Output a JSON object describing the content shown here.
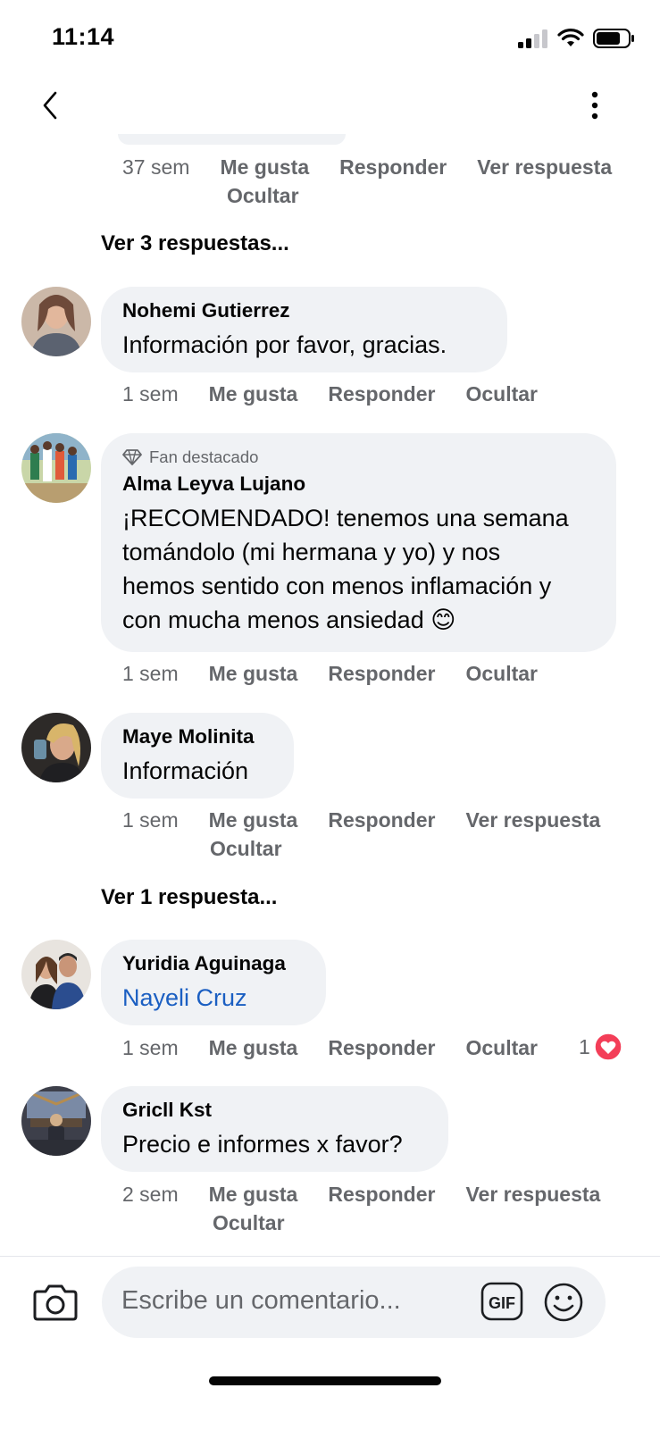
{
  "status": {
    "time": "11:14"
  },
  "prev_comment": {
    "time": "37 sem",
    "actions": [
      "Me gusta",
      "Responder",
      "Ver respuesta",
      "Ocultar"
    ]
  },
  "view_replies_1": "Ver 3 respuestas...",
  "comments": [
    {
      "author": "Nohemi Gutierrez",
      "text": "Información por favor,  gracias.",
      "time": "1 sem",
      "actions": [
        "Me gusta",
        "Responder",
        "Ocultar"
      ]
    },
    {
      "badge": "Fan destacado",
      "author": "Alma Leyva Lujano",
      "text_lines": [
        "¡RECOMENDADO! tenemos una semana",
        "tomándolo (mi hermana y yo) y nos",
        "hemos sentido con menos inflamación y",
        "con mucha menos ansiedad 😊"
      ],
      "time": "1 sem",
      "actions": [
        "Me gusta",
        "Responder",
        "Ocultar"
      ]
    },
    {
      "author": "Maye Molinita",
      "text": "Información",
      "time": "1 sem",
      "actions": [
        "Me gusta",
        "Responder",
        "Ver respuesta",
        "Ocultar"
      ]
    },
    {
      "author": "Yuridia Aguinaga",
      "text": "Nayeli Cruz",
      "time": "1 sem",
      "actions": [
        "Me gusta",
        "Responder",
        "Ocultar"
      ],
      "reaction_count": "1"
    },
    {
      "author": "Gricll Kst",
      "text": "Precio e informes x favor?",
      "time": "2 sem",
      "actions": [
        "Me gusta",
        "Responder",
        "Ver respuesta",
        "Ocultar"
      ]
    }
  ],
  "view_replies_2": "Ver 1 respuesta...",
  "composer": {
    "placeholder": "Escribe un comentario...",
    "gif_label": "GIF"
  },
  "colors": {
    "bubble": "#f0f2f5",
    "mention": "#1b5fc2",
    "reaction": "#f33e58",
    "meta": "#65676b"
  },
  "icons": [
    "back-icon",
    "more-icon",
    "diamond-icon",
    "heart-reaction-icon",
    "camera-icon",
    "gif-icon",
    "smiley-icon"
  ]
}
